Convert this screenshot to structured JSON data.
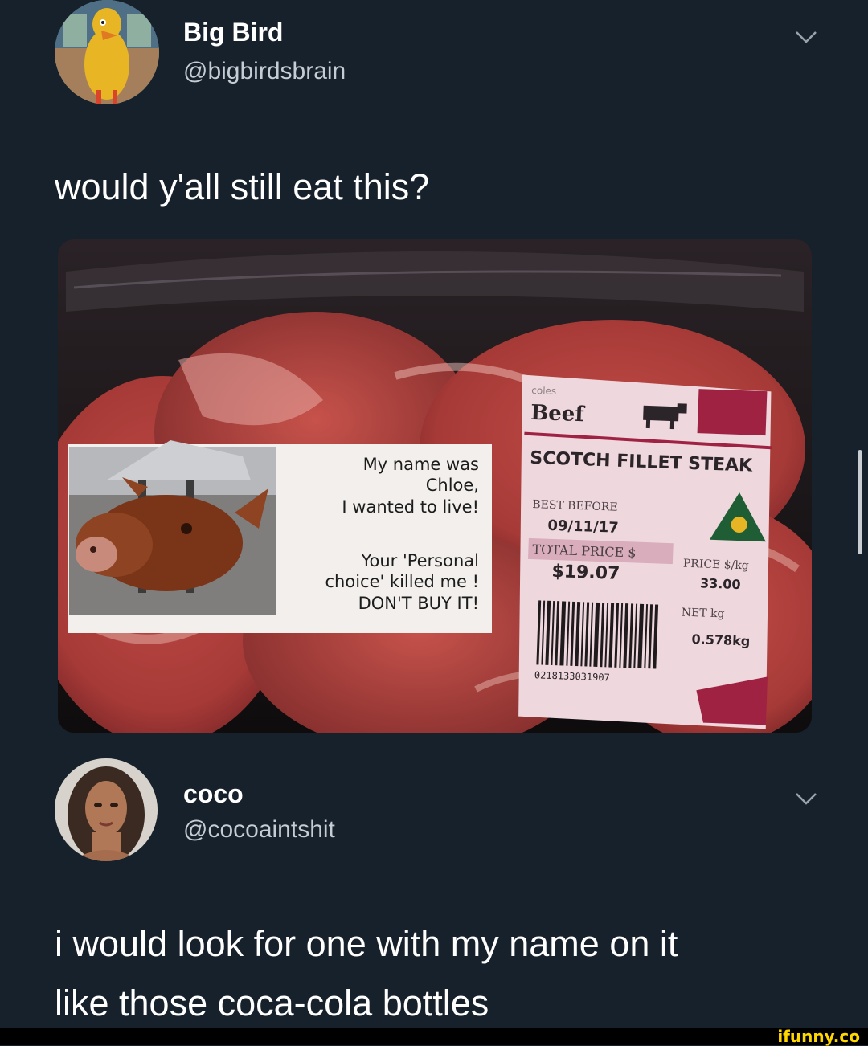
{
  "tweet1": {
    "display_name": "Big Bird",
    "handle": "@bigbirdsbrain",
    "text": "would y'all still eat this?"
  },
  "photo": {
    "sign": {
      "line1": "My name was",
      "line2": "Chloe,",
      "line3": "I wanted to live!",
      "line4": "Your 'Personal",
      "line5": "choice' killed me !",
      "line6": "DON'T BUY IT!"
    },
    "label": {
      "brand": "coles",
      "product_type": "Beef",
      "product_name": "SCOTCH FILLET STEAK",
      "best_before_label": "BEST BEFORE",
      "best_before_value": "09/11/17",
      "total_price_label": "TOTAL PRICE $",
      "total_price_value": "$19.07",
      "price_per_kg_label": "PRICE $/kg",
      "price_per_kg_value": "33.00",
      "net_kg_label": "NET kg",
      "net_kg_value": "0.578kg",
      "barcode_digits": "0218133031907"
    }
  },
  "tweet2": {
    "display_name": "coco",
    "handle": "@cocoaintshit",
    "text_line1": "i would look for one with my name on it",
    "text_line2": "like those coca-cola bottles"
  },
  "watermark": "ifunny.co"
}
